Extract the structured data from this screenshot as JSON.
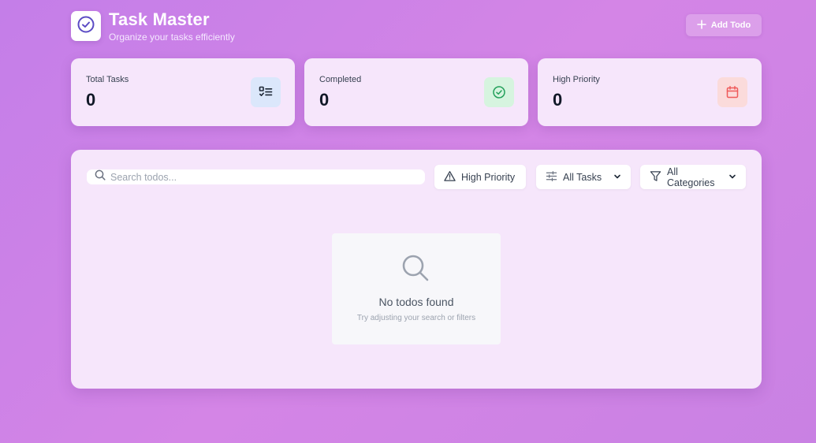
{
  "header": {
    "title": "Task Master",
    "subtitle": "Organize your tasks efficiently",
    "logo_icon": "check-circle-icon",
    "add_button_label": "Add Todo"
  },
  "stats": [
    {
      "label": "Total Tasks",
      "value": "0",
      "icon": "list-check-icon",
      "icon_bg": "#dbe7fb",
      "icon_color": "#1f2937"
    },
    {
      "label": "Completed",
      "value": "0",
      "icon": "check-circle-icon",
      "icon_bg": "#d6f4df",
      "icon_color": "#22a05a"
    },
    {
      "label": "High Priority",
      "value": "0",
      "icon": "calendar-icon",
      "icon_bg": "#fbdbdb",
      "icon_color": "#ef5b5b"
    }
  ],
  "toolbar": {
    "search_placeholder": "Search todos...",
    "priority_filter_label": "High Priority",
    "status_filter_value": "All Tasks",
    "category_filter_value": "All Categories"
  },
  "empty_state": {
    "title": "No todos found",
    "subtitle": "Try adjusting your search or filters"
  },
  "colors": {
    "background_gradient": "#c47ee8",
    "card_background": "#f6e6fb",
    "accent_purple": "#5b4bc4"
  }
}
